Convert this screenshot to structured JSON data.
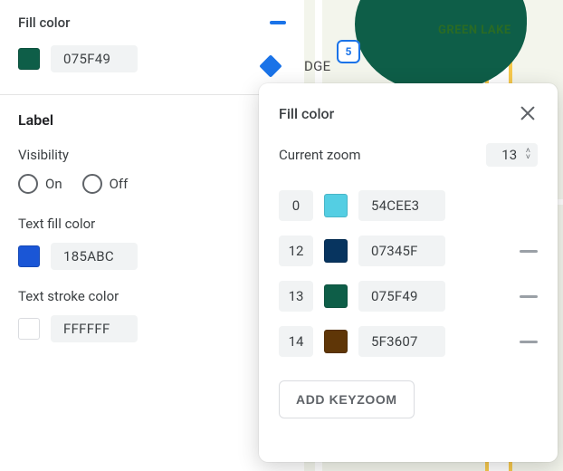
{
  "panel": {
    "fill_color_label": "Fill color",
    "fill_swatch": "#0e5e48",
    "fill_hex": "075F49",
    "label_section_title": "Label",
    "visibility_label": "Visibility",
    "visibility_on": "On",
    "visibility_off": "Off",
    "text_fill_label": "Text fill color",
    "text_fill_swatch": "#1a56d6",
    "text_fill_hex": "185ABC",
    "text_stroke_label": "Text stroke color",
    "text_stroke_swatch": "#ffffff",
    "text_stroke_hex": "FFFFFF"
  },
  "map": {
    "interstate": "5",
    "label_green_lake": "GREEN LAKE",
    "label_dge": "DGE"
  },
  "popover": {
    "title": "Fill color",
    "current_zoom_label": "Current zoom",
    "current_zoom_value": "13",
    "stops": [
      {
        "zoom": "0",
        "swatch": "#54cee3",
        "hex": "54CEE3",
        "removable": false
      },
      {
        "zoom": "12",
        "swatch": "#07345f",
        "hex": "07345F",
        "removable": true
      },
      {
        "zoom": "13",
        "swatch": "#0e5e48",
        "hex": "075F49",
        "removable": true
      },
      {
        "zoom": "14",
        "swatch": "#5f3607",
        "hex": "5F3607",
        "removable": true
      }
    ],
    "add_button": "ADD KEYZOOM"
  }
}
